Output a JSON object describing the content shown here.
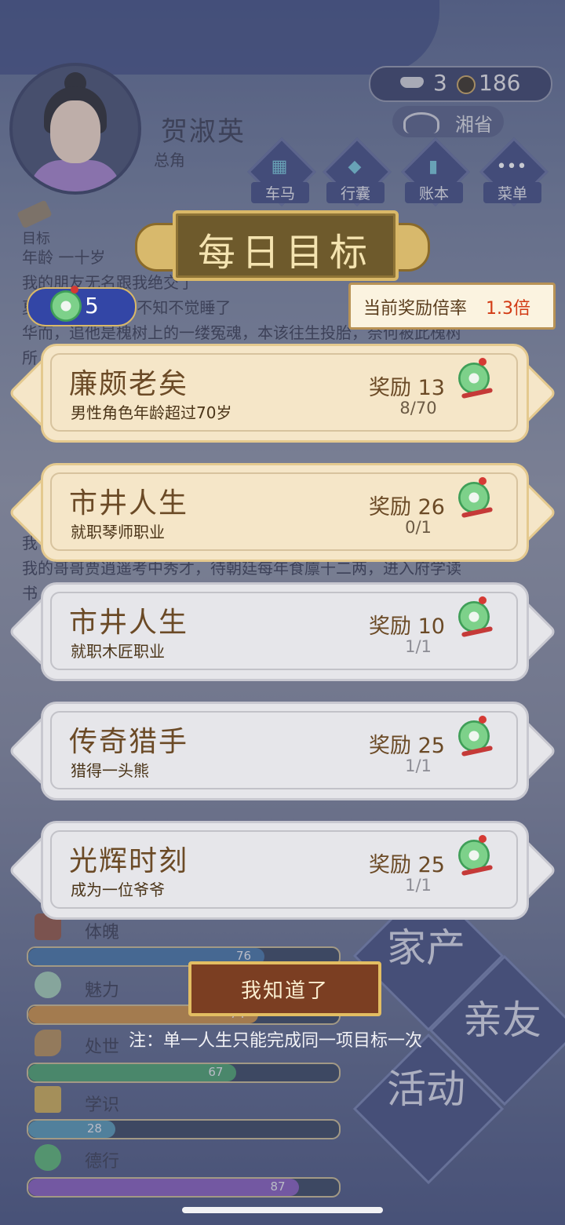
{
  "character": {
    "name": "贺淑英",
    "role": "总角"
  },
  "currency": {
    "ingot": "3",
    "coin": "186"
  },
  "region": "湘省",
  "top_menu": [
    {
      "label": "车马"
    },
    {
      "label": "行囊"
    },
    {
      "label": "账本"
    },
    {
      "label": "菜单"
    }
  ],
  "side_goal_label": "目标",
  "bio": {
    "age": "年龄 一十岁",
    "line1": "我的朋友无名跟我绝交了",
    "line2": "夏     在院中乘凉，不知不觉睡了",
    "line3": "华而，追他是槐树上的一缕冤魂，本该往生投胎，奈何被此槐树",
    "line4": "所",
    "line5": "我",
    "line6": "我的哥哥贾逍遥考中秀才，待朝廷每年食廪十二两，进入府学读",
    "line7": "书"
  },
  "dialog": {
    "title": "每日目标",
    "jade_count": "5",
    "rate_label": "当前奖励倍率",
    "rate_value": "1.3倍",
    "reward_label": "奖励",
    "goals": [
      {
        "title": "廉颇老矣",
        "desc": "男性角色年龄超过70岁",
        "reward": "13",
        "progress": "8/70",
        "status": "active"
      },
      {
        "title": "市井人生",
        "desc": "就职琴师职业",
        "reward": "26",
        "progress": "0/1",
        "status": "active"
      },
      {
        "title": "市井人生",
        "desc": "就职木匠职业",
        "reward": "10",
        "progress": "1/1",
        "status": "done"
      },
      {
        "title": "传奇猎手",
        "desc": "猎得一头熊",
        "reward": "25",
        "progress": "1/1",
        "status": "done"
      },
      {
        "title": "光辉时刻",
        "desc": "成为一位爷爷",
        "reward": "25",
        "progress": "1/1",
        "status": "done"
      }
    ],
    "confirm_label": "我知道了",
    "note": "注：单一人生只能完成同一项目标一次"
  },
  "stats": [
    {
      "label": "体魄",
      "value": "76",
      "fill": 0.76,
      "color": "#3a6aa0"
    },
    {
      "label": "魅力",
      "value": "74",
      "fill": 0.74,
      "color": "#c8883a"
    },
    {
      "label": "处世",
      "value": "67",
      "fill": 0.67,
      "color": "#3f9a64"
    },
    {
      "label": "学识",
      "value": "28",
      "fill": 0.28,
      "color": "#4a8fb0"
    },
    {
      "label": "德行",
      "value": "87",
      "fill": 0.87,
      "color": "#7e52b8"
    }
  ],
  "side_menu": {
    "family_property": "家产",
    "relatives": "亲友",
    "activity": "活动"
  }
}
